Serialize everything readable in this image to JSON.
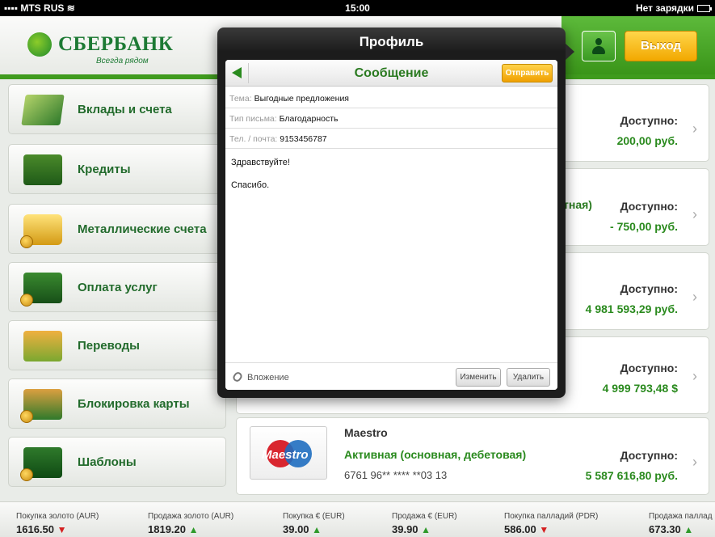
{
  "status_bar": {
    "carrier": "MTS RUS",
    "time": "15:00",
    "battery": "Нет зарядки"
  },
  "header": {
    "brand": "СБЕРБАНК",
    "slogan": "Всегда рядом",
    "logout_label": "Выход"
  },
  "sidebar": {
    "items": [
      {
        "label": "Вклады и счета",
        "icon": "cash-icon"
      },
      {
        "label": "Кредиты",
        "icon": "wallet-icon"
      },
      {
        "label": "Металлические счета",
        "icon": "gold-bars-icon"
      },
      {
        "label": "Оплата услуг",
        "icon": "briefcase-icon"
      },
      {
        "label": "Переводы",
        "icon": "transfer-icon"
      },
      {
        "label": "Блокировка карты",
        "icon": "lock-icon"
      },
      {
        "label": "Шаблоны",
        "icon": "folder-icon"
      }
    ]
  },
  "accounts": [
    {
      "fragment": ")",
      "available_label": "Доступно:",
      "available": "200,00 руб."
    },
    {
      "fragment": "тная)",
      "available_label": "Доступно:",
      "available": "- 750,00 руб."
    },
    {
      "fragment": "",
      "available_label": "Доступно:",
      "available": "4 981 593,29 руб."
    },
    {
      "fragment": "",
      "available_label": "Доступно:",
      "available": "4 999 793,48 $"
    },
    {
      "card_logo": "Maestro",
      "name": "Maestro",
      "status": "Активная (основная, дебетовая)",
      "number": "6761 96** **** **03 13",
      "available_label": "Доступно:",
      "available": "5 587 616,80 руб."
    }
  ],
  "ticker": [
    {
      "label": "Покупка золото (AUR)",
      "value": "1616.50",
      "trend": "down"
    },
    {
      "label": "Продажа золото (AUR)",
      "value": "1819.20",
      "trend": "up"
    },
    {
      "label": "Покупка € (EUR)",
      "value": "39.00",
      "trend": "up"
    },
    {
      "label": "Продажа € (EUR)",
      "value": "39.90",
      "trend": "up"
    },
    {
      "label": "Покупка палладий (PDR)",
      "value": "586.00",
      "trend": "down"
    },
    {
      "label": "Продажа паллад",
      "value": "673.30",
      "trend": "up"
    }
  ],
  "modal": {
    "title": "Профиль",
    "inner_title": "Сообщение",
    "send_label": "Отправить",
    "fields": [
      {
        "label": "Тема:",
        "value": "Выгодные предложения"
      },
      {
        "label": "Тип письма:",
        "value": "Благодарность"
      },
      {
        "label": "Тел. / почта:",
        "value": "9153456787"
      }
    ],
    "body_lines": [
      "Здравствуйте!",
      "Спасибо."
    ],
    "attachment_label": "Вложение",
    "edit_label": "Изменить",
    "delete_label": "Удалить"
  },
  "colors": {
    "brand_green": "#2a8a1e",
    "accent_yellow": "#f0a000",
    "down_red": "#d42020"
  }
}
